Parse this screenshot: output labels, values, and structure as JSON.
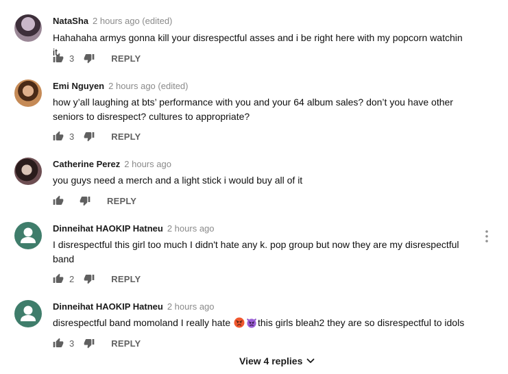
{
  "comments": [
    {
      "author": "NataSha",
      "time": "2 hours ago (edited)",
      "text": "Hahahaha armys gonna kill your disrespectful asses and i be right here with my popcorn watchin it",
      "likes": "3",
      "reply": "REPLY"
    },
    {
      "author": "Emi Nguyen",
      "time": "2 hours ago (edited)",
      "text": "how y’all laughing at bts’ performance with you and your 64 album sales? don’t you have other seniors to disrespect? cultures to appropriate?",
      "likes": "3",
      "reply": "REPLY"
    },
    {
      "author": "Catherine Perez",
      "time": "2 hours ago",
      "text": "you guys need a merch and a light stick i would buy all of it",
      "likes": "",
      "reply": "REPLY"
    },
    {
      "author": "Dinneihat HAOKIP Hatneu",
      "time": "2 hours ago",
      "text": "I disrespectful this girl too much I didn't hate any k. pop group but now they are my disrespectful band",
      "likes": "2",
      "reply": "REPLY"
    },
    {
      "author": "Dinneihat HAOKIP Hatneu",
      "time": "2 hours ago",
      "text_before": "disrespectful band momoland I really hate ",
      "text_after": "this girls bleah2 they are so disrespectful to idols",
      "emojis": [
        "angry-face-icon",
        "angry-devil-icon"
      ],
      "likes": "3",
      "reply": "REPLY"
    }
  ],
  "view_replies": "View 4 replies",
  "icons": {
    "like": "thumbs-up-icon",
    "dislike": "thumbs-down-icon",
    "more": "more-vertical-icon",
    "chevron": "chevron-down-icon"
  }
}
